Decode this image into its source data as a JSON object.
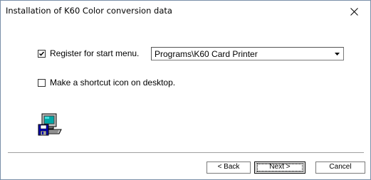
{
  "window": {
    "title": "Installation of K60 Color conversion data"
  },
  "options": {
    "register_start_menu": {
      "label": "Register for start menu.",
      "checked": true
    },
    "start_menu_folder": {
      "selected": "Programs\\K60 Card Printer"
    },
    "desktop_shortcut": {
      "label": "Make a shortcut icon on desktop.",
      "checked": false
    }
  },
  "icons": {
    "close": "close-icon",
    "setup": "computer-floppy-icon",
    "dropdown": "chevron-down-icon"
  },
  "buttons": {
    "back_label": "< Back",
    "next_label": "Next >",
    "cancel_label": "Cancel"
  }
}
